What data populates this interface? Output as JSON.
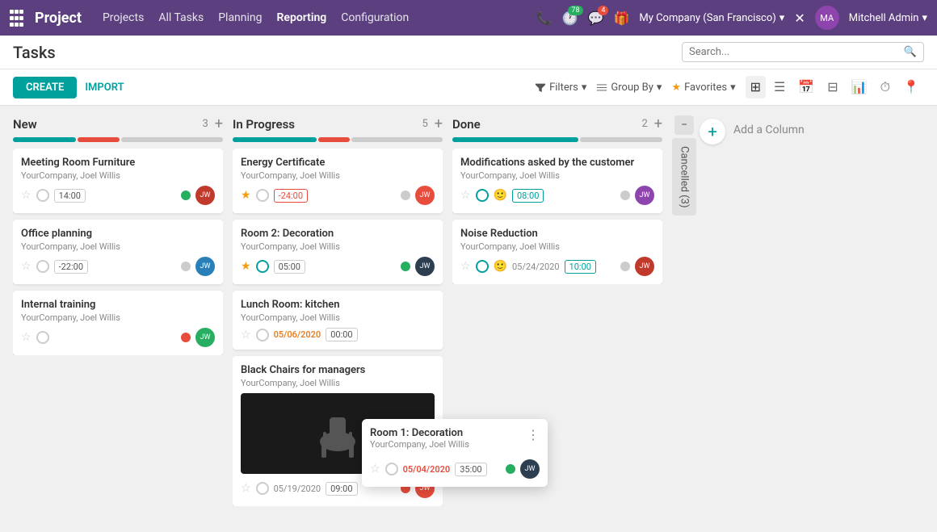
{
  "app": {
    "grid_icon": "⊞",
    "logo": "Project"
  },
  "topnav": {
    "links": [
      "Projects",
      "All Tasks",
      "Planning",
      "Reporting",
      "Configuration"
    ],
    "active_link": "Reporting",
    "phone_icon": "📞",
    "clock_badge": "78",
    "chat_badge": "4",
    "gift_icon": "🎁",
    "company": "My Company (San Francisco)",
    "close_icon": "✕",
    "user": "Mitchell Admin"
  },
  "page": {
    "title": "Tasks",
    "search_placeholder": "Search..."
  },
  "toolbar": {
    "create_label": "CREATE",
    "import_label": "IMPORT",
    "filters_label": "Filters",
    "groupby_label": "Group By",
    "favorites_label": "Favorites"
  },
  "columns": [
    {
      "id": "new",
      "title": "New",
      "count": "3",
      "prog_green": 30,
      "prog_red": 20,
      "cards": [
        {
          "title": "Meeting Room Furniture",
          "sub": "YourCompany, Joel Willis",
          "starred": false,
          "time": "14:00",
          "time_style": "normal",
          "status": "green",
          "has_avatar": true
        },
        {
          "title": "Office planning",
          "sub": "YourCompany, Joel Willis",
          "starred": false,
          "time": "-22:00",
          "time_style": "normal",
          "status": "gray",
          "has_avatar": true
        },
        {
          "title": "Internal training",
          "sub": "YourCompany, Joel Willis",
          "starred": false,
          "time": null,
          "time_style": "normal",
          "status": "red",
          "has_avatar": true
        }
      ]
    },
    {
      "id": "inprogress",
      "title": "In Progress",
      "count": "5",
      "prog_green": 40,
      "prog_red": 15,
      "cards": [
        {
          "title": "Energy Certificate",
          "sub": "YourCompany, Joel Willis",
          "starred": true,
          "time": "-24:00",
          "time_style": "red",
          "status": "gray",
          "has_avatar": true
        },
        {
          "title": "Room 2: Decoration",
          "sub": "YourCompany, Joel Willis",
          "starred": true,
          "time": "05:00",
          "time_style": "normal",
          "status": "green",
          "has_avatar": true
        },
        {
          "title": "Lunch Room: kitchen",
          "sub": "YourCompany, Joel Willis",
          "starred": false,
          "date": "05/06/2020",
          "time": "00:00",
          "time_style": "normal",
          "status": null,
          "has_avatar": false
        },
        {
          "title": "Black Chairs for managers",
          "sub": "YourCompany, Joel Willis",
          "starred": false,
          "date": "05/19/2020",
          "time": "09:00",
          "time_style": "normal",
          "status": "red",
          "has_avatar": true,
          "has_image": true
        }
      ]
    },
    {
      "id": "done",
      "title": "Done",
      "count": "2",
      "prog_green": 60,
      "prog_red": 0,
      "cards": [
        {
          "title": "Modifications asked by the customer",
          "sub": "YourCompany, Joel Willis",
          "starred": false,
          "time": "08:00",
          "time_style": "green",
          "status": "gray",
          "has_avatar": true,
          "has_smiley": true
        },
        {
          "title": "Noise Reduction",
          "sub": "YourCompany, Joel Willis",
          "starred": false,
          "date": "05/24/2020",
          "time": "10:00",
          "time_style": "green",
          "status": "gray",
          "has_avatar": true,
          "has_smiley": true
        }
      ]
    }
  ],
  "cancelled": {
    "label": "Cancelled (3)"
  },
  "add_column": {
    "label": "Add a Column"
  },
  "floating_card": {
    "title": "Room 1: Decoration",
    "sub": "YourCompany, Joel Willis",
    "date": "05/04/2020",
    "time": "35:00",
    "time_style": "normal",
    "status": "green",
    "has_avatar": true
  }
}
